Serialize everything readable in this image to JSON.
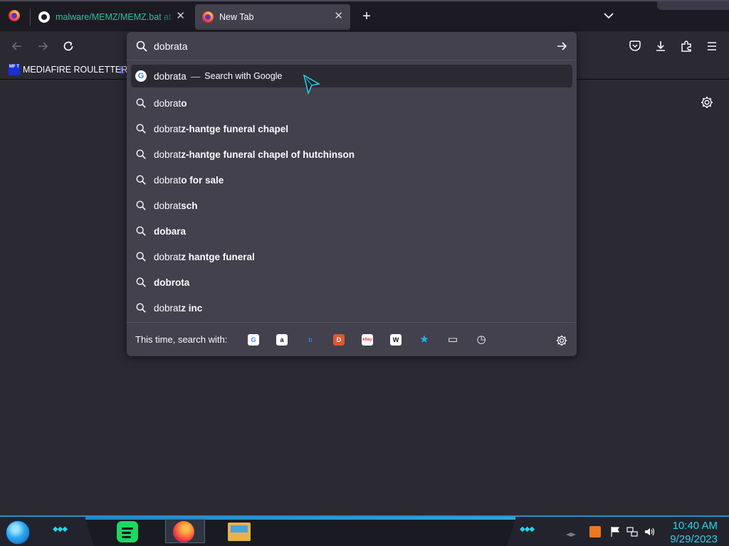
{
  "tabs": [
    {
      "title": "malware/MEMZ/MEMZ.bat at",
      "close": "✕",
      "active": false
    },
    {
      "title": "New Tab",
      "close": "✕",
      "active": true
    }
  ],
  "tabstrip": {
    "new_tab": "+"
  },
  "bookmarks": {
    "items": [
      {
        "label": "MEDIAFIRE ROULETTER",
        "favicon_text": "MF T"
      }
    ],
    "overflow_glyph": "Σ"
  },
  "urlbar": {
    "value": "dobrata",
    "heuristic": {
      "text": "dobrata",
      "separator": "—",
      "action": "Search with Google"
    },
    "suggestions": [
      {
        "prefix": "dobrat",
        "suffix": "o"
      },
      {
        "prefix": "dobrat",
        "suffix": "z-hantge funeral chapel"
      },
      {
        "prefix": "dobrat",
        "suffix": "z-hantge funeral chapel of hutchinson"
      },
      {
        "prefix": "dobrat",
        "suffix": "o for sale"
      },
      {
        "prefix": "dobrat",
        "suffix": "sch"
      },
      {
        "prefix": "",
        "suffix": "dobara"
      },
      {
        "prefix": "dobrat",
        "suffix": "z hantge funeral"
      },
      {
        "prefix": "",
        "suffix": "dobrota"
      },
      {
        "prefix": "dobrat",
        "suffix": "z inc"
      }
    ],
    "oneoff_label": "This time, search with:",
    "engines": [
      {
        "name": "google",
        "glyph": "G",
        "bg": "#ffffff",
        "fg": "#4285f4"
      },
      {
        "name": "amazon",
        "glyph": "a",
        "bg": "#ffffff",
        "fg": "#111111"
      },
      {
        "name": "bing",
        "glyph": "b",
        "bg": "transparent",
        "fg": "#2a7de1"
      },
      {
        "name": "duckduckgo",
        "glyph": "D",
        "bg": "#de5833",
        "fg": "#ffffff"
      },
      {
        "name": "ebay",
        "glyph": "ebay",
        "bg": "#ffffff",
        "fg": "#e53238"
      },
      {
        "name": "wikipedia",
        "glyph": "W",
        "bg": "#ffffff",
        "fg": "#111111"
      },
      {
        "name": "bookmarks",
        "glyph": "★",
        "bg": "transparent",
        "fg": "#1fb6e8"
      },
      {
        "name": "tabs",
        "glyph": "▭",
        "bg": "transparent",
        "fg": "#fbfbfe"
      },
      {
        "name": "history",
        "glyph": "◷",
        "bg": "transparent",
        "fg": "#fbfbfe"
      }
    ]
  },
  "clock": {
    "time": "10:40 AM",
    "date": "9/29/2023"
  },
  "colors": {
    "accent": "#2ac3a2",
    "taskbar_accent": "#26d6e8",
    "browser_bg": "#2b2a33"
  }
}
